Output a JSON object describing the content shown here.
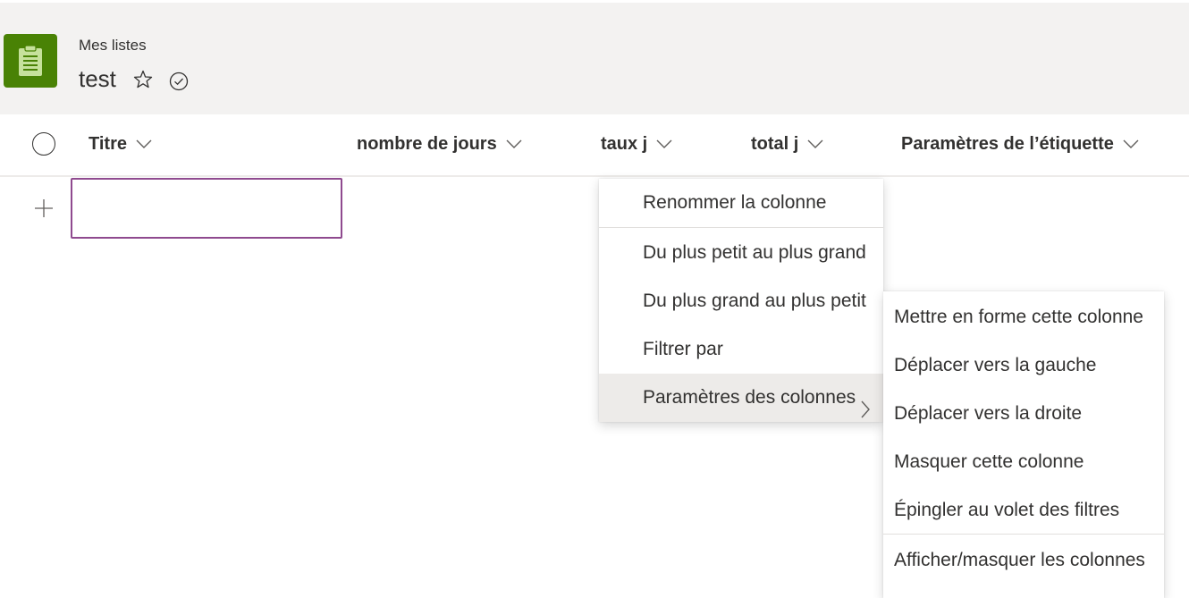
{
  "header": {
    "breadcrumb": "Mes listes",
    "list_title": "test",
    "icon": "clipboard-list-icon",
    "brand_color": "#498205"
  },
  "columns": [
    {
      "label": "Titre"
    },
    {
      "label": "nombre de jours"
    },
    {
      "label": "taux j"
    },
    {
      "label": "total j"
    },
    {
      "label": "Paramètres de l’étiquette"
    }
  ],
  "column_menu": {
    "items": [
      {
        "label": "Renommer la colonne"
      },
      {
        "label": "Du plus petit au plus grand"
      },
      {
        "label": "Du plus grand au plus petit"
      },
      {
        "label": "Filtrer par"
      },
      {
        "label": "Paramètres des colonnes"
      }
    ]
  },
  "column_settings_submenu": {
    "items": [
      {
        "label": "Mettre en forme cette colonne"
      },
      {
        "label": "Déplacer vers la gauche"
      },
      {
        "label": "Déplacer vers la droite"
      },
      {
        "label": "Masquer cette colonne"
      },
      {
        "label": "Épingler au volet des filtres"
      },
      {
        "label": "Afficher/masquer les colonnes"
      }
    ]
  },
  "new_row": {
    "title_value": ""
  },
  "colors": {
    "input_border": "#8f4a8f",
    "header_bg": "#f3f2f1",
    "active_item_bg": "#edebe9"
  }
}
